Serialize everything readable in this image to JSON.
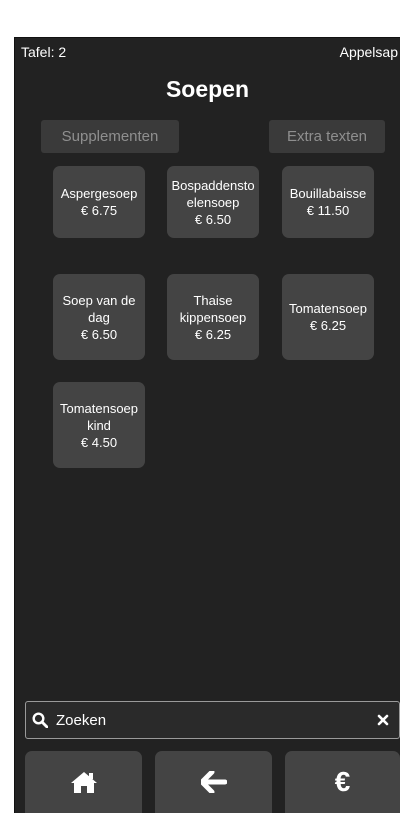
{
  "header": {
    "table": "Tafel: 2",
    "order_item": "Appelsap"
  },
  "title": "Soepen",
  "options": {
    "supplements": "Supplementen",
    "extra_texts": "Extra texten"
  },
  "products": [
    {
      "name": "Aspergesoep",
      "price": "€ 6.75"
    },
    {
      "name": "Bospaddenstoelensoep",
      "price": "€ 6.50"
    },
    {
      "name": "Bouillabaisse",
      "price": "€ 11.50"
    },
    {
      "name": "Soep van de dag",
      "price": "€ 6.50"
    },
    {
      "name": "Thaise kippensoep",
      "price": "€ 6.25"
    },
    {
      "name": "Tomatensoep",
      "price": "€ 6.25"
    },
    {
      "name": "Tomatensoep kind",
      "price": "€ 4.50"
    }
  ],
  "search": {
    "placeholder": "Zoeken"
  },
  "nav": {
    "pay_symbol": "€"
  },
  "icons": {
    "search": "search-icon",
    "clear": "close-icon",
    "home": "home-icon",
    "back": "arrow-left-icon"
  }
}
